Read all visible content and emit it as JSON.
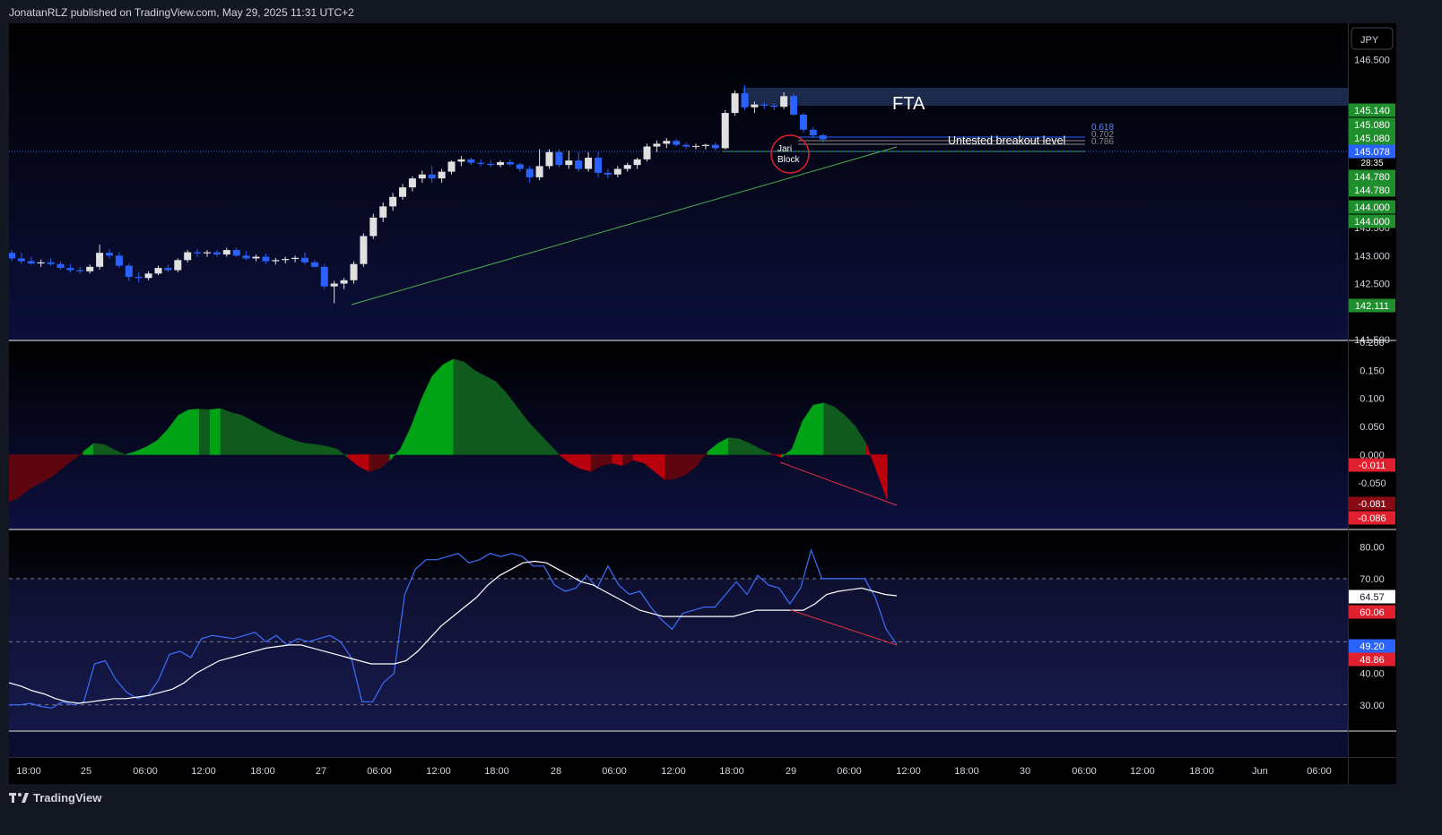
{
  "header": {
    "publish_line": "JonatanRLZ published on TradingView.com, May 29, 2025 11:31 UTC+2"
  },
  "footer": {
    "brand": "TradingView",
    "logo_icon": "tradingview-logo-icon"
  },
  "currency_button": "JPY",
  "colors": {
    "bg_dark": "#131722",
    "pane_top": "#000000",
    "pane_bottom": "#0c0f3a",
    "candle_up": "#e0e0e0",
    "candle_down": "#2962ff",
    "rsi": "#3d6fff",
    "rsi_ma": "#ffffff",
    "osc_up_strong": "#00a316",
    "osc_up_weak": "#0f5a1c",
    "osc_down_strong": "#b8000d",
    "osc_down_weak": "#5e0610",
    "label_green": "#1f8f2e",
    "label_red": "#e0202f"
  },
  "chart_data": [
    {
      "type": "candlestick",
      "pane": "price",
      "yaxis_ticks": [
        "146.500",
        "145.140",
        "145.080",
        "145.080",
        "145.078",
        "144.780",
        "144.780",
        "144.000",
        "144.000",
        "143.500",
        "143.000",
        "142.500",
        "142.111",
        "141.500"
      ],
      "ylim": [
        141.5,
        146.8
      ],
      "last_price": 145.078,
      "countdown": "28:35",
      "price_labels": [
        {
          "value": 145.14,
          "text": "145.140",
          "color": "#1f8f2e"
        },
        {
          "value": 145.08,
          "text": "145.080",
          "color": "#1f8f2e"
        },
        {
          "value": 145.08,
          "text": "145.080",
          "color": "#1f8f2e"
        },
        {
          "value": 145.078,
          "text": "145.078",
          "color": "#2962ff"
        },
        {
          "value": 144.78,
          "text": "144.780",
          "color": "#1f8f2e"
        },
        {
          "value": 144.78,
          "text": "144.780",
          "color": "#1f8f2e"
        },
        {
          "value": 144.0,
          "text": "144.000",
          "color": "#1f8f2e"
        },
        {
          "value": 144.0,
          "text": "144.000",
          "color": "#1f8f2e"
        },
        {
          "value": 142.111,
          "text": "142.111",
          "color": "#1f8f2e"
        }
      ],
      "plain_ticks": [
        {
          "value": 146.5,
          "text": "146.500"
        },
        {
          "value": 143.5,
          "text": "143.500"
        },
        {
          "value": 143.0,
          "text": "143.000"
        },
        {
          "value": 142.5,
          "text": "142.500"
        },
        {
          "value": 141.5,
          "text": "141.500"
        }
      ],
      "annotations": {
        "zone_label": "FTA",
        "breakout_label": "Untested breakout level",
        "fib_labels": [
          "0.618",
          "0.702",
          "0.786"
        ],
        "circle_label_1": "Jari",
        "circle_label_2": "Block"
      },
      "candles": [
        [
          143.05,
          143.1,
          142.9,
          142.95
        ],
        [
          142.95,
          143.05,
          142.85,
          142.9
        ],
        [
          142.9,
          142.98,
          142.84,
          142.86
        ],
        [
          142.86,
          142.93,
          142.8,
          142.88
        ],
        [
          142.88,
          142.95,
          142.82,
          142.85
        ],
        [
          142.85,
          142.9,
          142.75,
          142.78
        ],
        [
          142.78,
          142.85,
          142.7,
          142.74
        ],
        [
          142.74,
          142.8,
          142.68,
          142.72
        ],
        [
          142.72,
          142.84,
          142.68,
          142.8
        ],
        [
          142.8,
          143.2,
          142.75,
          143.05
        ],
        [
          143.05,
          143.12,
          142.95,
          143.0
        ],
        [
          143.0,
          143.06,
          142.78,
          142.82
        ],
        [
          142.82,
          142.86,
          142.55,
          142.62
        ],
        [
          142.62,
          142.7,
          142.52,
          142.6
        ],
        [
          142.6,
          142.72,
          142.56,
          142.68
        ],
        [
          142.68,
          142.82,
          142.65,
          142.78
        ],
        [
          142.78,
          142.84,
          142.7,
          142.74
        ],
        [
          142.74,
          142.95,
          142.7,
          142.92
        ],
        [
          142.92,
          143.1,
          142.88,
          143.06
        ],
        [
          143.06,
          143.12,
          142.98,
          143.04
        ],
        [
          143.04,
          143.1,
          142.98,
          143.06
        ],
        [
          143.06,
          143.1,
          142.98,
          143.02
        ],
        [
          143.02,
          143.14,
          142.98,
          143.1
        ],
        [
          143.1,
          143.14,
          142.98,
          143.0
        ],
        [
          143.0,
          143.08,
          142.92,
          142.95
        ],
        [
          142.95,
          143.02,
          142.9,
          142.98
        ],
        [
          142.98,
          143.04,
          142.85,
          142.9
        ],
        [
          142.9,
          142.96,
          142.84,
          142.92
        ],
        [
          142.92,
          142.98,
          142.86,
          142.94
        ],
        [
          142.94,
          143.0,
          142.88,
          142.96
        ],
        [
          142.96,
          143.06,
          142.84,
          142.88
        ],
        [
          142.88,
          142.92,
          142.78,
          142.8
        ],
        [
          142.8,
          142.85,
          142.4,
          142.45
        ],
        [
          142.45,
          142.55,
          142.15,
          142.5
        ],
        [
          142.5,
          142.6,
          142.4,
          142.56
        ],
        [
          142.56,
          142.9,
          142.5,
          142.85
        ],
        [
          142.85,
          143.4,
          142.8,
          143.35
        ],
        [
          143.35,
          143.75,
          143.3,
          143.68
        ],
        [
          143.68,
          143.95,
          143.6,
          143.88
        ],
        [
          143.88,
          144.12,
          143.8,
          144.05
        ],
        [
          144.05,
          144.28,
          144.0,
          144.22
        ],
        [
          144.22,
          144.42,
          144.15,
          144.38
        ],
        [
          144.38,
          144.52,
          144.3,
          144.45
        ],
        [
          144.45,
          144.6,
          144.3,
          144.38
        ],
        [
          144.38,
          144.55,
          144.3,
          144.5
        ],
        [
          144.5,
          144.7,
          144.45,
          144.68
        ],
        [
          144.68,
          144.78,
          144.6,
          144.72
        ],
        [
          144.72,
          144.75,
          144.62,
          144.66
        ],
        [
          144.66,
          144.72,
          144.6,
          144.64
        ],
        [
          144.64,
          144.7,
          144.58,
          144.62
        ],
        [
          144.62,
          144.7,
          144.58,
          144.67
        ],
        [
          144.67,
          144.72,
          144.6,
          144.63
        ],
        [
          144.63,
          144.66,
          144.5,
          144.55
        ],
        [
          144.55,
          144.6,
          144.3,
          144.4
        ],
        [
          144.4,
          144.9,
          144.35,
          144.6
        ],
        [
          144.6,
          144.9,
          144.55,
          144.85
        ],
        [
          144.85,
          144.9,
          144.58,
          144.62
        ],
        [
          144.62,
          144.88,
          144.55,
          144.7
        ],
        [
          144.7,
          144.85,
          144.5,
          144.55
        ],
        [
          144.55,
          144.85,
          144.5,
          144.75
        ],
        [
          144.75,
          144.85,
          144.4,
          144.48
        ],
        [
          144.48,
          144.55,
          144.38,
          144.45
        ],
        [
          144.45,
          144.6,
          144.4,
          144.55
        ],
        [
          144.55,
          144.66,
          144.5,
          144.62
        ],
        [
          144.62,
          144.75,
          144.55,
          144.72
        ],
        [
          144.72,
          145.0,
          144.68,
          144.95
        ],
        [
          144.95,
          145.06,
          144.85,
          145.0
        ],
        [
          145.0,
          145.1,
          144.92,
          145.05
        ],
        [
          145.05,
          145.08,
          144.95,
          144.98
        ],
        [
          144.98,
          145.02,
          144.9,
          144.95
        ],
        [
          144.95,
          145.0,
          144.9,
          144.96
        ],
        [
          144.96,
          145.0,
          144.9,
          144.98
        ],
        [
          144.98,
          145.02,
          144.88,
          144.92
        ],
        [
          144.92,
          145.6,
          144.9,
          145.55
        ],
        [
          145.55,
          145.95,
          145.5,
          145.9
        ],
        [
          145.9,
          146.05,
          145.6,
          145.65
        ],
        [
          145.65,
          145.75,
          145.55,
          145.7
        ],
        [
          145.7,
          145.74,
          145.62,
          145.68
        ],
        [
          145.68,
          145.72,
          145.6,
          145.66
        ],
        [
          145.66,
          145.92,
          145.62,
          145.85
        ],
        [
          145.85,
          145.9,
          145.5,
          145.52
        ],
        [
          145.52,
          145.55,
          145.2,
          145.25
        ],
        [
          145.25,
          145.3,
          145.1,
          145.15
        ],
        [
          145.15,
          145.18,
          145.02,
          145.078
        ]
      ]
    },
    {
      "type": "area",
      "pane": "oscillator",
      "ylim": [
        -0.13,
        0.2
      ],
      "yaxis_ticks": [
        "0.200",
        "0.150",
        "0.100",
        "0.050",
        "0.000",
        "-0.050"
      ],
      "plain_ticks": [
        {
          "value": 0.2,
          "text": "0.200"
        },
        {
          "value": 0.15,
          "text": "0.150"
        },
        {
          "value": 0.1,
          "text": "0.100"
        },
        {
          "value": 0.05,
          "text": "0.050"
        },
        {
          "value": 0.0,
          "text": "0.000"
        },
        {
          "value": -0.05,
          "text": "-0.050"
        }
      ],
      "price_labels": [
        {
          "value": -0.011,
          "text": "-0.011",
          "color": "#e0202f"
        },
        {
          "value": -0.081,
          "text": "-0.081",
          "color": "#8a0a14"
        },
        {
          "value": -0.086,
          "text": "-0.086",
          "color": "#e0202f"
        }
      ],
      "values": [
        -0.085,
        -0.075,
        -0.06,
        -0.05,
        -0.04,
        -0.025,
        -0.01,
        0.005,
        0.02,
        0.018,
        0.008,
        0.0,
        0.006,
        0.014,
        0.025,
        0.045,
        0.07,
        0.08,
        0.081,
        0.08,
        0.082,
        0.075,
        0.07,
        0.06,
        0.05,
        0.04,
        0.032,
        0.025,
        0.02,
        0.018,
        0.015,
        0.01,
        -0.005,
        -0.02,
        -0.03,
        -0.025,
        -0.01,
        0.01,
        0.05,
        0.1,
        0.14,
        0.16,
        0.17,
        0.165,
        0.15,
        0.14,
        0.13,
        0.11,
        0.085,
        0.06,
        0.04,
        0.02,
        0.0,
        -0.015,
        -0.025,
        -0.03,
        -0.02,
        -0.015,
        -0.02,
        -0.01,
        -0.015,
        -0.03,
        -0.045,
        -0.043,
        -0.035,
        -0.02,
        0.005,
        0.02,
        0.03,
        0.028,
        0.02,
        0.01,
        0.002,
        -0.005,
        0.01,
        0.06,
        0.088,
        0.092,
        0.085,
        0.07,
        0.05,
        0.02,
        -0.03,
        -0.081
      ]
    },
    {
      "type": "line",
      "pane": "rsi",
      "ylim": [
        22,
        85
      ],
      "yaxis_ticks": [
        "80.00",
        "70.00",
        "40.00",
        "30.00"
      ],
      "plain_ticks": [
        {
          "value": 80,
          "text": "80.00"
        },
        {
          "value": 70,
          "text": "70.00"
        },
        {
          "value": 40,
          "text": "40.00"
        },
        {
          "value": 30,
          "text": "30.00"
        }
      ],
      "price_labels": [
        {
          "value": 64.57,
          "text": "64.57",
          "color": "#ffffff"
        },
        {
          "value": 60.06,
          "text": "60.06",
          "color": "#e0202f"
        },
        {
          "value": 49.2,
          "text": "49.20",
          "color": "#2962ff"
        },
        {
          "value": 48.86,
          "text": "48.86",
          "color": "#e0202f"
        }
      ],
      "bands": [
        70,
        50,
        30
      ],
      "series": [
        {
          "values": [
            30,
            30,
            30.5,
            29.5,
            29,
            31,
            30,
            31,
            43,
            44,
            38,
            34,
            32,
            33,
            38,
            46,
            47,
            45,
            51,
            52,
            51.5,
            51,
            52,
            53,
            50,
            52,
            49,
            51,
            50,
            51,
            52,
            50,
            45,
            31,
            31,
            37,
            40,
            65,
            73,
            76,
            76,
            77,
            78,
            75,
            76,
            78,
            77,
            78,
            77,
            74,
            74,
            68,
            66,
            67,
            71,
            67,
            74,
            68,
            65,
            66,
            61,
            57,
            54,
            59,
            60,
            61,
            61,
            65,
            69,
            65,
            71,
            68,
            67,
            62,
            67,
            79,
            70,
            70,
            70,
            70,
            70,
            64,
            54,
            49.2
          ]
        },
        {
          "values": [
            37,
            36,
            34.5,
            33.5,
            32,
            31,
            30.5,
            31,
            31.5,
            32,
            32,
            32.5,
            33,
            34,
            35,
            37,
            40,
            42,
            44,
            45,
            46,
            47,
            48,
            48.5,
            49,
            49,
            48,
            47,
            46,
            45,
            44,
            43,
            43,
            43,
            44,
            47,
            51,
            55,
            58,
            61,
            64,
            68,
            71,
            73,
            75,
            75.5,
            75,
            73,
            71,
            69,
            68,
            66,
            64,
            62,
            60,
            59,
            58,
            58,
            58,
            58,
            58,
            58,
            58,
            59,
            60,
            60,
            60,
            60,
            60,
            62,
            65,
            66,
            66.5,
            67,
            66,
            65,
            64.57
          ]
        }
      ]
    }
  ],
  "x_axis": {
    "labels": [
      {
        "text": "18:00",
        "x": 22
      },
      {
        "text": "25",
        "x": 86
      },
      {
        "text": "06:00",
        "x": 152
      },
      {
        "text": "12:00",
        "x": 217
      },
      {
        "text": "18:00",
        "x": 283
      },
      {
        "text": "27",
        "x": 348
      },
      {
        "text": "06:00",
        "x": 413
      },
      {
        "text": "12:00",
        "x": 479
      },
      {
        "text": "18:00",
        "x": 544
      },
      {
        "text": "28",
        "x": 610
      },
      {
        "text": "06:00",
        "x": 675
      },
      {
        "text": "12:00",
        "x": 741
      },
      {
        "text": "18:00",
        "x": 806
      },
      {
        "text": "29",
        "x": 872
      },
      {
        "text": "06:00",
        "x": 937
      },
      {
        "text": "12:00",
        "x": 1003
      },
      {
        "text": "18:00",
        "x": 1068
      },
      {
        "text": "30",
        "x": 1133
      },
      {
        "text": "06:00",
        "x": 1199
      },
      {
        "text": "12:00",
        "x": 1264
      },
      {
        "text": "18:00",
        "x": 1330
      },
      {
        "text": "Jun",
        "x": 1395
      },
      {
        "text": "06:00",
        "x": 1461
      }
    ]
  }
}
